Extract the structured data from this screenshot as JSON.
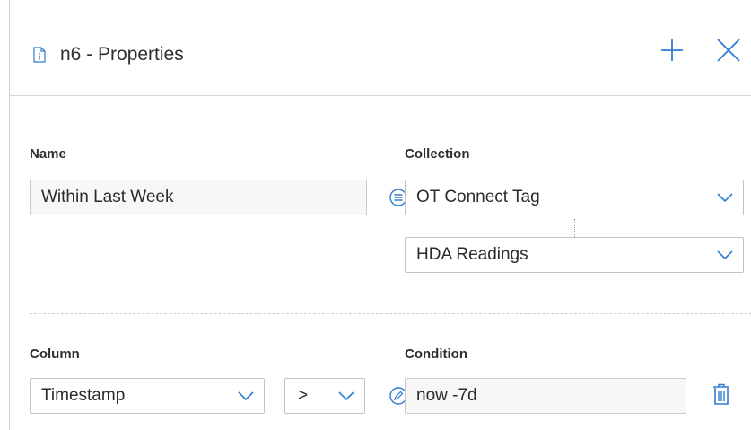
{
  "header": {
    "title": "n6 - Properties",
    "add_icon": "plus-icon",
    "close_icon": "close-icon",
    "doc_icon": "info-document-icon"
  },
  "name_section": {
    "label": "Name",
    "value": "Within Last Week"
  },
  "collection_section": {
    "label": "Collection",
    "primary_value": "OT Connect Tag",
    "secondary_value": "HDA Readings",
    "link_icon": "list-circle-icon"
  },
  "column_section": {
    "label": "Column",
    "value": "Timestamp"
  },
  "operator": {
    "value": ">"
  },
  "condition_section": {
    "label": "Condition",
    "value": "now -7d",
    "edit_icon": "pencil-circle-icon"
  },
  "actions": {
    "delete_icon": "trash-icon"
  },
  "colors": {
    "accent": "#2e7bd1",
    "border": "#c9c9c9",
    "text": "#2b2b2b"
  }
}
